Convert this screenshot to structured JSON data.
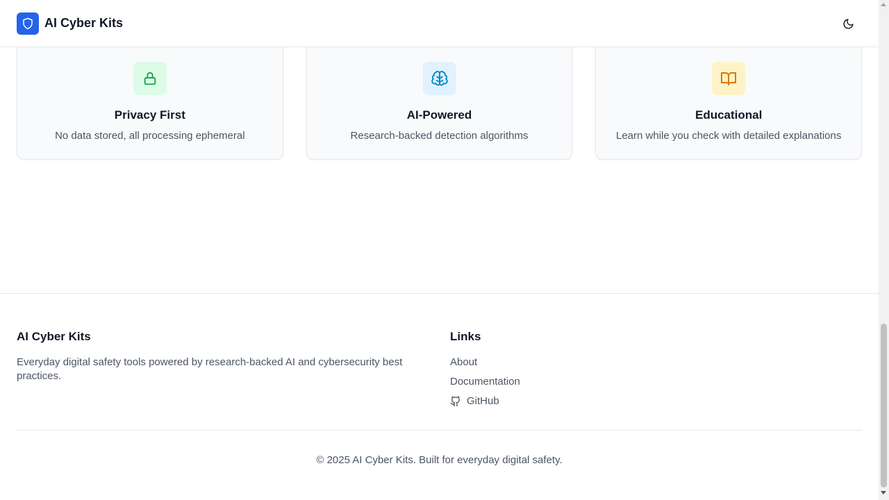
{
  "header": {
    "brand": "AI Cyber Kits",
    "logo_icon": "shield-icon",
    "theme_toggle_icon": "moon-icon"
  },
  "features": [
    {
      "icon": "lock-icon",
      "accent": "#16a34a",
      "bg": "#dcfce7",
      "title": "Privacy First",
      "description": "No data stored, all processing ephemeral"
    },
    {
      "icon": "brain-icon",
      "accent": "#0284c7",
      "bg": "#e0f2fe",
      "title": "AI-Powered",
      "description": "Research-backed detection algorithms"
    },
    {
      "icon": "book-open-icon",
      "accent": "#d97706",
      "bg": "#fef3c7",
      "title": "Educational",
      "description": "Learn while you check with detailed explanations"
    }
  ],
  "footer": {
    "brand": "AI Cyber Kits",
    "tagline": "Everyday digital safety tools powered by research-backed AI and cybersecurity best practices.",
    "links_heading": "Links",
    "links": [
      {
        "label": "About"
      },
      {
        "label": "Documentation"
      },
      {
        "label": "GitHub",
        "icon": "github-icon"
      }
    ],
    "copyright": "© 2025 AI Cyber Kits. Built for everyday digital safety."
  },
  "colors": {
    "brand_blue": "#2563eb",
    "text_primary": "#111827",
    "text_secondary": "#4b5563",
    "border": "#e5e7eb"
  }
}
